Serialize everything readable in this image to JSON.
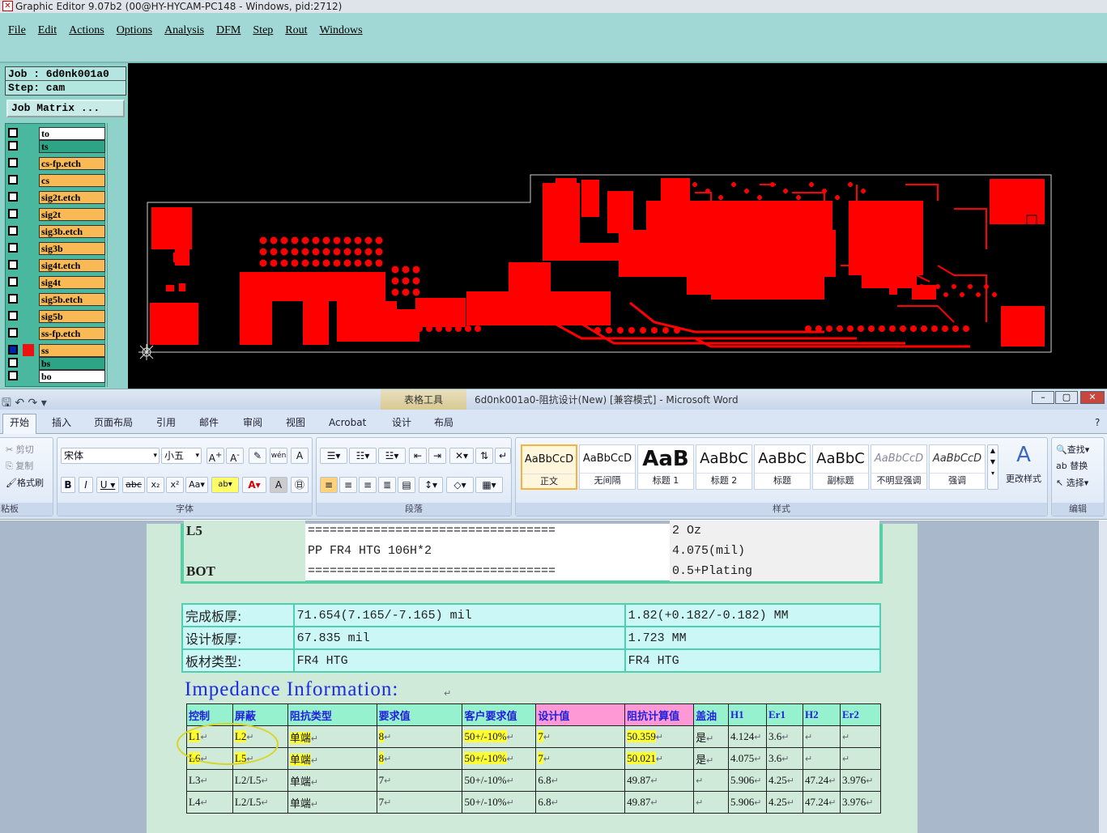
{
  "editor": {
    "title": "Graphic Editor 9.07b2 (00@HY-HYCAM-PC148 - Windows, pid:2712)",
    "menu": [
      "File",
      "Edit",
      "Actions",
      "Options",
      "Analysis",
      "DFM",
      "Step",
      "Rout",
      "Windows"
    ],
    "job_label": "Job : 6d0nk001a0",
    "step_label": "Step: cam",
    "job_matrix_label": "Job Matrix ...",
    "layers": [
      {
        "name": "to",
        "color": "#ffffff"
      },
      {
        "name": "ts",
        "color": "#2ea486"
      },
      {
        "name": "cs-fp.etch",
        "color": "#f9b955"
      },
      {
        "name": "cs",
        "color": "#f9b955"
      },
      {
        "name": "sig2t.etch",
        "color": "#f9b955"
      },
      {
        "name": "sig2t",
        "color": "#f9b955"
      },
      {
        "name": "sig3b.etch",
        "color": "#f9b955"
      },
      {
        "name": "sig3b",
        "color": "#f9b955"
      },
      {
        "name": "sig4t.etch",
        "color": "#f9b955"
      },
      {
        "name": "sig4t",
        "color": "#f9b955"
      },
      {
        "name": "sig5b.etch",
        "color": "#f9b955"
      },
      {
        "name": "sig5b",
        "color": "#f9b955"
      },
      {
        "name": "ss-fp.etch",
        "color": "#f9b955"
      },
      {
        "name": "ss",
        "color": "#f9b955"
      },
      {
        "name": "bs",
        "color": "#2ea486"
      },
      {
        "name": "bo",
        "color": "#ffffff"
      }
    ],
    "board_text": "6d0nk001a0",
    "trace_color": "#ff0000"
  },
  "word": {
    "context_tab": "表格工具",
    "title": "6d0nk001a0-阻抗设计(New) [兼容模式] - Microsoft Word",
    "tabs": [
      "开始",
      "插入",
      "页面布局",
      "引用",
      "邮件",
      "审阅",
      "视图",
      "Acrobat",
      "设计",
      "布局"
    ],
    "clipboard": {
      "cut": "剪切",
      "copy": "复制",
      "format_painter": "格式刷",
      "label": "粘板"
    },
    "font": {
      "name": "宋体",
      "size": "小五",
      "label": "字体"
    },
    "paragraph_label": "段落",
    "styles": [
      {
        "preview": "AaBbCcD",
        "name": "正文"
      },
      {
        "preview": "AaBbCcD",
        "name": "无间隔"
      },
      {
        "preview": "AaB",
        "name": "标题 1"
      },
      {
        "preview": "AaBbC",
        "name": "标题 2"
      },
      {
        "preview": "AaBbC",
        "name": "标题"
      },
      {
        "preview": "AaBbC",
        "name": "副标题"
      },
      {
        "preview": "AaBbCcD",
        "name": "不明显强调"
      },
      {
        "preview": "AaBbCcD",
        "name": "强调"
      }
    ],
    "styles_label": "样式",
    "change_styles": "更改样式",
    "editing": {
      "find": "查找",
      "replace": "替换",
      "select": "选择",
      "label": "编辑"
    },
    "stackup": [
      {
        "layer": "L5",
        "material": "==================================",
        "value": "2 Oz"
      },
      {
        "layer": "",
        "material": "PP     FR4 HTG    106H*2",
        "value": "4.075(mil)"
      },
      {
        "layer": "BOT",
        "material": "==================================",
        "value": "0.5+Plating"
      }
    ],
    "board_info": [
      {
        "label": "完成板厚:",
        "mil": "71.654(7.165/-7.165) mil",
        "mm": "1.82(+0.182/-0.182) MM"
      },
      {
        "label": "设计板厚:",
        "mil": "67.835 mil",
        "mm": "1.723 MM"
      },
      {
        "label": "板材类型:",
        "mil": "FR4 HTG",
        "mm": "FR4 HTG"
      }
    ],
    "impedance_title": "Impedance Information:",
    "impedance_headers": [
      "控制",
      "屏蔽",
      "阻抗类型",
      "要求值",
      "客户要求值",
      "设计值",
      "阻抗计算值",
      "盖油",
      "H1",
      "Er1",
      "H2",
      "Er2"
    ],
    "impedance_rows": [
      [
        "L1",
        "L2",
        "单端",
        "8",
        "50+/-10%",
        "7",
        "50.359",
        "是",
        "4.124",
        "3.6",
        "",
        ""
      ],
      [
        "L6",
        "L5",
        "单端",
        "8",
        "50+/-10%",
        "7",
        "50.021",
        "是",
        "4.075",
        "3.6",
        "",
        ""
      ],
      [
        "L3",
        "L2/L5",
        "单端",
        "7",
        "50+/-10%",
        "6.8",
        "49.87",
        "",
        "5.906",
        "4.25",
        "47.24",
        "3.976"
      ],
      [
        "L4",
        "L2/L5",
        "单端",
        "7",
        "50+/-10%",
        "6.8",
        "49.87",
        "",
        "5.906",
        "4.25",
        "47.24",
        "3.976"
      ]
    ]
  }
}
